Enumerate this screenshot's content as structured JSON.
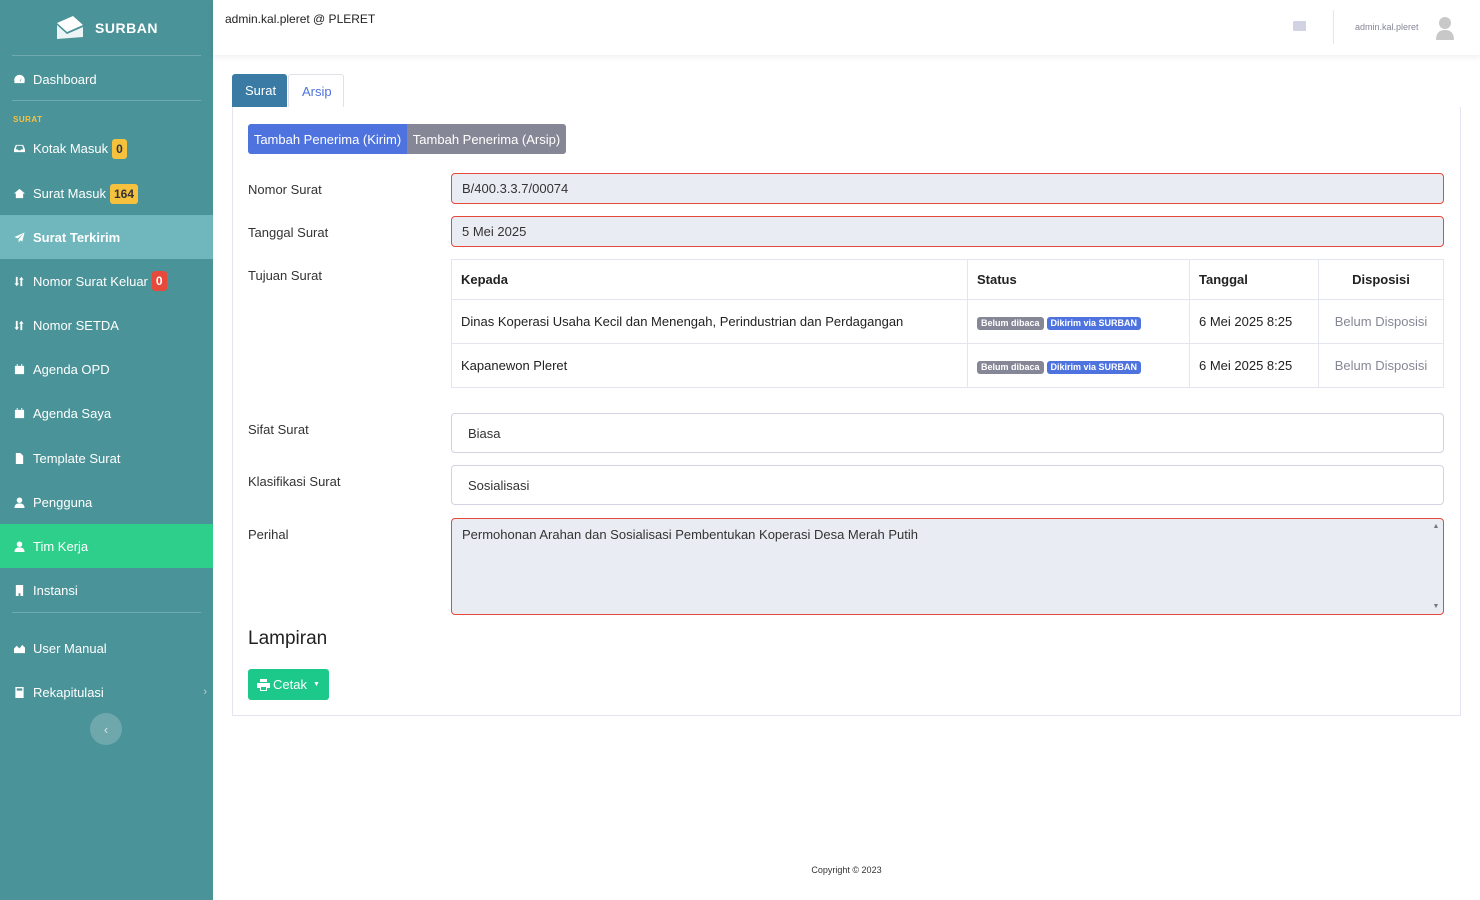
{
  "brand": {
    "name": "SURBAN"
  },
  "sidebar": {
    "section_label": "SURAT",
    "items": [
      {
        "label": "Dashboard",
        "icon": "dashboard-icon"
      },
      {
        "label": "Kotak Masuk",
        "icon": "inbox-icon",
        "badge": "0"
      },
      {
        "label": "Surat Masuk",
        "icon": "home-icon",
        "badge": "164"
      },
      {
        "label": "Surat Terkirim",
        "icon": "paper-plane-icon"
      },
      {
        "label": "Nomor Surat Keluar",
        "icon": "sort-icon",
        "badge": "0"
      },
      {
        "label": "Nomor SETDA",
        "icon": "sort-icon"
      },
      {
        "label": "Agenda OPD",
        "icon": "calendar-icon"
      },
      {
        "label": "Agenda Saya",
        "icon": "calendar-icon"
      },
      {
        "label": "Template Surat",
        "icon": "file-icon"
      },
      {
        "label": "Pengguna",
        "icon": "user-icon"
      },
      {
        "label": "Tim Kerja",
        "icon": "user-icon"
      },
      {
        "label": "Instansi",
        "icon": "building-icon"
      },
      {
        "label": "User Manual",
        "icon": "chart-area-icon"
      },
      {
        "label": "Rekapitulasi",
        "icon": "calculator-icon"
      }
    ],
    "collapse_glyph": "‹"
  },
  "topbar": {
    "title": "admin.kal.pleret @ PLERET",
    "username": "admin.kal.pleret"
  },
  "tabs": [
    {
      "label": "Surat"
    },
    {
      "label": "Arsip"
    }
  ],
  "actions": {
    "kirim_label": "Tambah Penerima (Kirim)",
    "arsip_label": "Tambah Penerima (Arsip)"
  },
  "form": {
    "nomor_label": "Nomor Surat",
    "nomor_value": "B/400.3.3.7/00074",
    "tanggal_label": "Tanggal Surat",
    "tanggal_value": "5 Mei 2025",
    "tujuan_label": "Tujuan Surat",
    "sifat_label": "Sifat Surat",
    "sifat_value": "Biasa",
    "klasifikasi_label": "Klasifikasi Surat",
    "klasifikasi_value": "Sosialisasi",
    "perihal_label": "Perihal",
    "perihal_value": "Permohonan Arahan dan Sosialisasi Pembentukan Koperasi Desa Merah Putih"
  },
  "table": {
    "headers": [
      "Kepada",
      "Status",
      "Tanggal",
      "Disposisi"
    ],
    "rows": [
      {
        "kepada": "Dinas Koperasi Usaha Kecil dan Menengah, Perindustrian dan Perdagangan",
        "status_read": "Belum dibaca",
        "status_sent": "Dikirim via SURBAN",
        "tanggal": "6 Mei 2025 8:25",
        "disposisi": "Belum Disposisi"
      },
      {
        "kepada": "Kapanewon Pleret",
        "status_read": "Belum dibaca",
        "status_sent": "Dikirim via SURBAN",
        "tanggal": "6 Mei 2025 8:25",
        "disposisi": "Belum Disposisi"
      }
    ]
  },
  "lampiran": {
    "heading": "Lampiran",
    "cetak_label": "Cetak"
  },
  "footer": {
    "text": "Copyright © 2023"
  },
  "colors": {
    "sidebar": "#4a9398",
    "sidebar_active": "#6fb7bc",
    "sidebar_active_green": "#2ecf8a",
    "primary": "#4e73df",
    "secondary": "#858796",
    "success": "#1cc88a",
    "danger": "#e74a3b",
    "warning": "#f6c23e"
  }
}
